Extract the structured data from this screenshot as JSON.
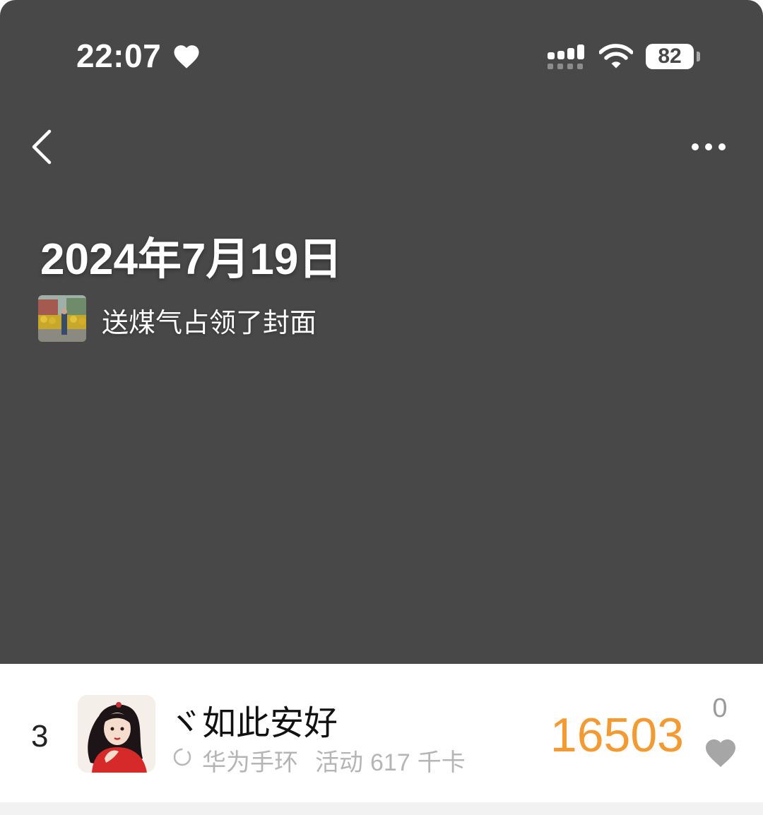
{
  "status_bar": {
    "time": "22:07",
    "battery": "82",
    "icons": [
      "heart-icon",
      "cellular-signal-icon",
      "wifi-icon",
      "battery-icon"
    ]
  },
  "nav": {
    "back_icon": "chevron-left-icon",
    "more_icon": "more-horizontal-icon"
  },
  "cover": {
    "date_title": "2024年7月19日",
    "caption": "送煤气占领了封面",
    "background_color": "#484848"
  },
  "ranking": {
    "rank": "3",
    "name": "ヾ如此安好",
    "source": "华为手环",
    "activity_label": "活动",
    "activity_value": "617",
    "activity_unit": "千卡",
    "steps": "16503",
    "like_count": "0",
    "steps_color": "#f39a33"
  }
}
